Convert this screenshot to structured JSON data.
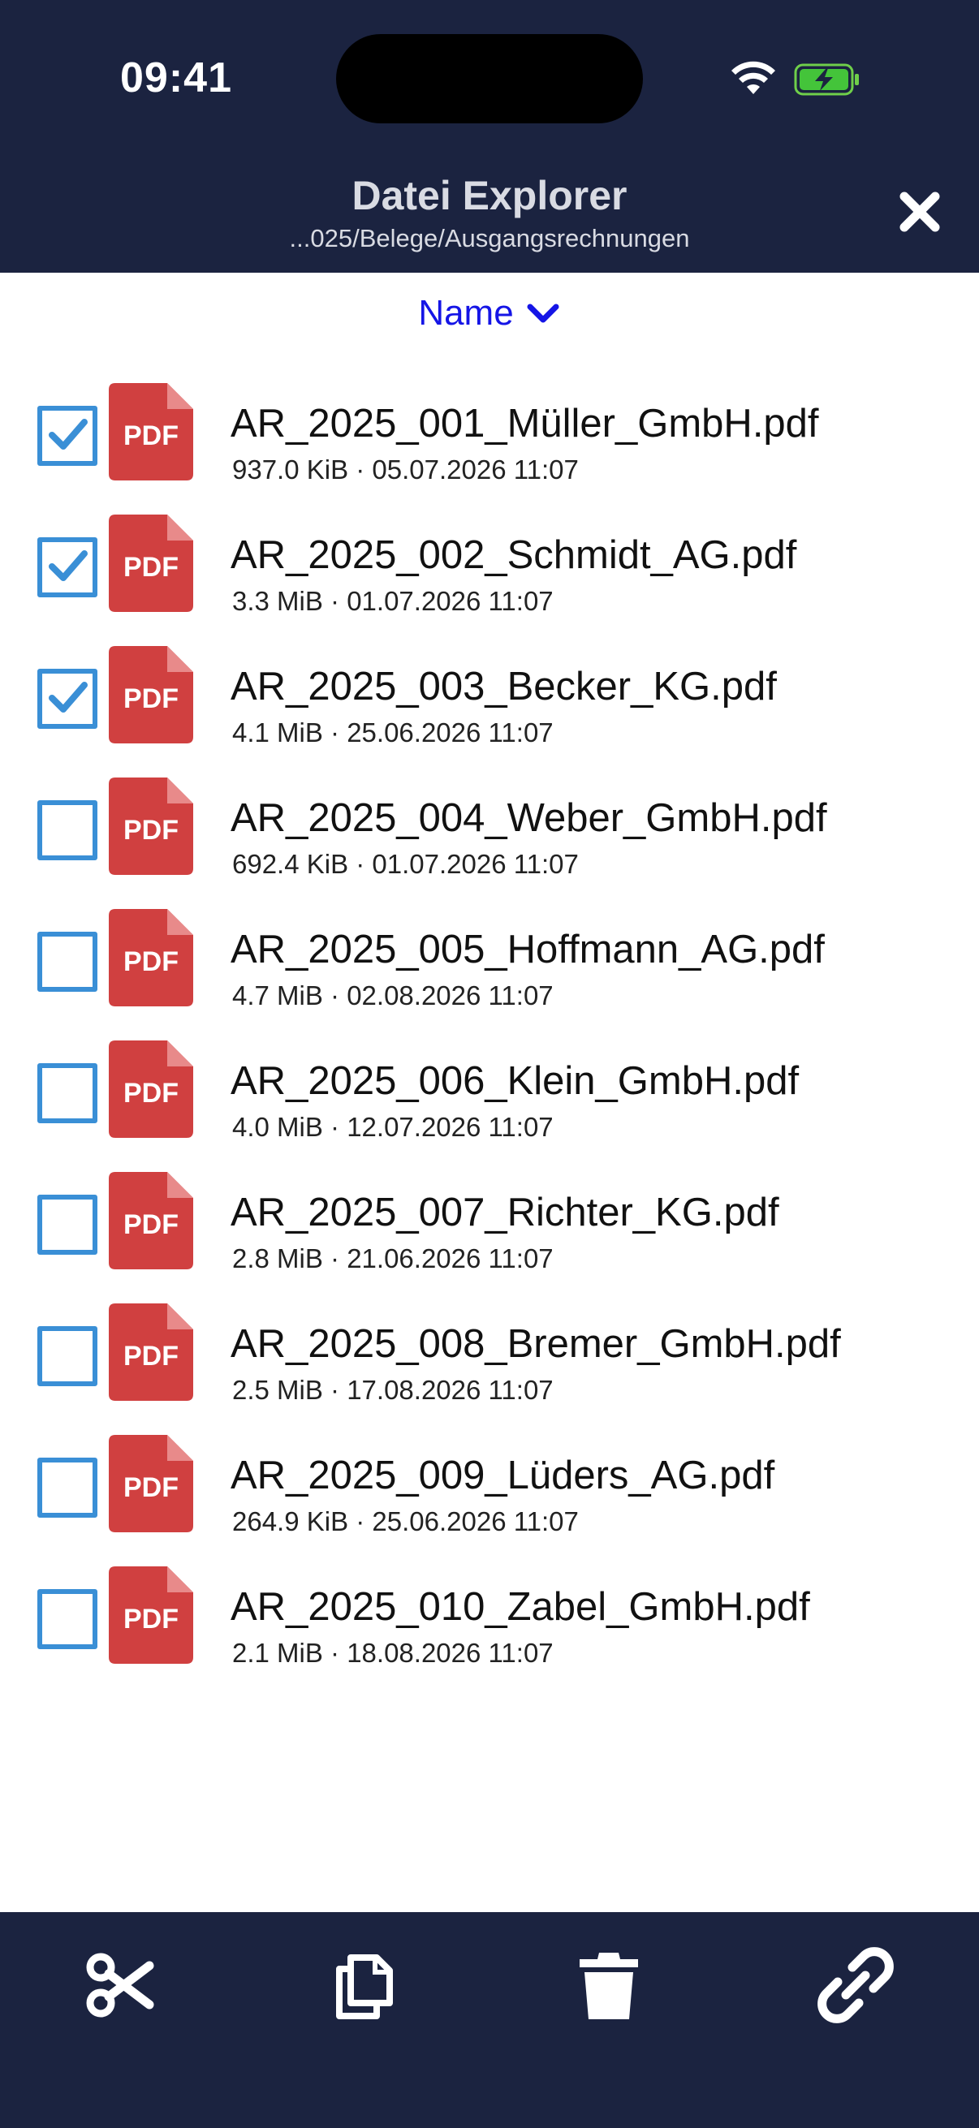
{
  "status_bar": {
    "time": "09:41"
  },
  "header": {
    "title": "Datei Explorer",
    "path": "...025/Belege/Ausgangsrechnungen"
  },
  "sort": {
    "label": "Name"
  },
  "pdf_icon_text": "PDF",
  "files": [
    {
      "name": "AR_2025_001_Müller_GmbH.pdf",
      "meta": "937.0 KiB · 05.07.2026 11:07",
      "checked": true
    },
    {
      "name": "AR_2025_002_Schmidt_AG.pdf",
      "meta": "3.3 MiB · 01.07.2026 11:07",
      "checked": true
    },
    {
      "name": "AR_2025_003_Becker_KG.pdf",
      "meta": "4.1 MiB · 25.06.2026 11:07",
      "checked": true
    },
    {
      "name": "AR_2025_004_Weber_GmbH.pdf",
      "meta": "692.4 KiB · 01.07.2026 11:07",
      "checked": false
    },
    {
      "name": "AR_2025_005_Hoffmann_AG.pdf",
      "meta": "4.7 MiB · 02.08.2026 11:07",
      "checked": false
    },
    {
      "name": "AR_2025_006_Klein_GmbH.pdf",
      "meta": "4.0 MiB · 12.07.2026 11:07",
      "checked": false
    },
    {
      "name": "AR_2025_007_Richter_KG.pdf",
      "meta": "2.8 MiB · 21.06.2026 11:07",
      "checked": false
    },
    {
      "name": "AR_2025_008_Bremer_GmbH.pdf",
      "meta": "2.5 MiB · 17.08.2026 11:07",
      "checked": false
    },
    {
      "name": "AR_2025_009_Lüders_AG.pdf",
      "meta": "264.9 KiB · 25.06.2026 11:07",
      "checked": false
    },
    {
      "name": "AR_2025_010_Zabel_GmbH.pdf",
      "meta": "2.1 MiB · 18.08.2026 11:07",
      "checked": false
    }
  ],
  "toolbar": {
    "actions": [
      "scissors-icon",
      "copy-icon",
      "trash-icon",
      "link-icon"
    ]
  },
  "colors": {
    "header_bg": "#1b2340",
    "accent_blue": "#1515e6",
    "checkbox_blue": "#3a8fd6",
    "pdf_red": "#d04040"
  }
}
